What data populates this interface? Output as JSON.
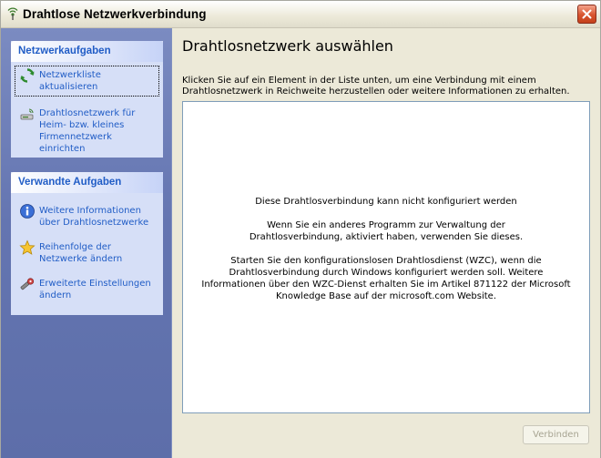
{
  "window": {
    "title": "Drahtlose Netzwerkverbindung"
  },
  "sidebar": {
    "network_tasks": {
      "header": "Netzwerkaufgaben",
      "items": [
        {
          "label": "Netzwerkliste aktualisieren",
          "icon": "refresh-icon"
        },
        {
          "label": "Drahtlosnetzwerk für Heim- bzw. kleines Firmennetzwerk einrichten",
          "icon": "wireless-setup-icon"
        }
      ]
    },
    "related_tasks": {
      "header": "Verwandte Aufgaben",
      "items": [
        {
          "label": "Weitere Informationen über Drahtlosnetzwerke",
          "icon": "info-icon"
        },
        {
          "label": "Reihenfolge der Netzwerke ändern",
          "icon": "star-icon"
        },
        {
          "label": "Erweiterte Einstellungen ändern",
          "icon": "settings-icon"
        }
      ]
    }
  },
  "main": {
    "title": "Drahtlosnetzwerk auswählen",
    "description": "Klicken Sie auf ein Element in der Liste unten, um eine Verbindung mit einem Drahtlosnetzwerk in Reichweite herzustellen oder weitere Informationen zu erhalten.",
    "messages": [
      "Diese Drahtlosverbindung kann nicht konfiguriert werden",
      "Wenn Sie ein anderes Programm zur Verwaltung der Drahtlosverbindung, aktiviert haben, verwenden Sie dieses.",
      "Starten Sie den konfigurationslosen Drahtlosdienst (WZC), wenn die Drahtlosverbindung durch Windows konfiguriert werden soll. Weitere Informationen über den WZC-Dienst erhalten Sie im Artikel 871122 der Microsoft Knowledge Base auf der microsoft.com Website."
    ],
    "connect_label": "Verbinden"
  },
  "colors": {
    "task_link": "#215dc6",
    "sidebar_bg": "#6475b1",
    "panel_bg": "#d6dff7",
    "window_bg": "#ece9d8"
  }
}
